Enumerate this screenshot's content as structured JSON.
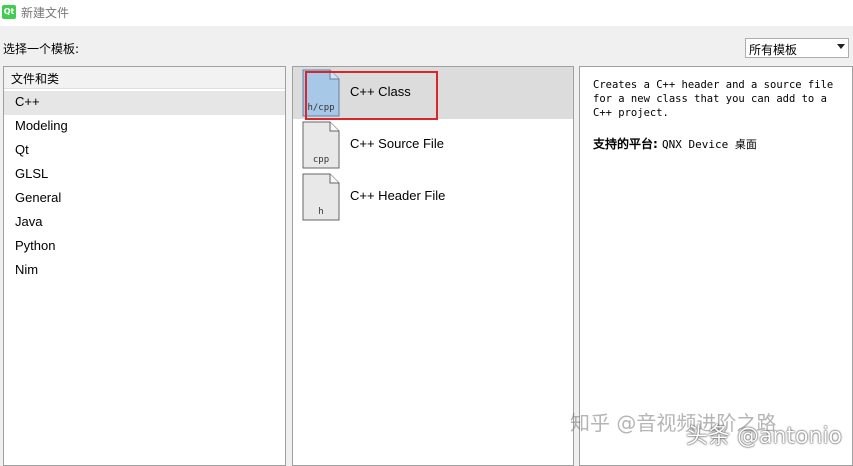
{
  "window": {
    "title": "新建文件",
    "app_icon": "Qt"
  },
  "prompt": "选择一个模板:",
  "filter": {
    "selected": "所有模板"
  },
  "categories": {
    "header": "文件和类",
    "items": [
      {
        "label": "C++",
        "selected": true
      },
      {
        "label": "Modeling"
      },
      {
        "label": "Qt"
      },
      {
        "label": "GLSL"
      },
      {
        "label": "General"
      },
      {
        "label": "Java"
      },
      {
        "label": "Python"
      },
      {
        "label": "Nim"
      }
    ]
  },
  "templates": [
    {
      "label": "C++ Class",
      "icon_text": "h/cpp",
      "selected": true,
      "icon_color": "#a8c8e8"
    },
    {
      "label": "C++ Source File",
      "icon_text": "cpp",
      "icon_color": "#e8e8e8"
    },
    {
      "label": "C++ Header File",
      "icon_text": "h",
      "icon_color": "#e8e8e8"
    }
  ],
  "details": {
    "description": "Creates a C++ header and a source file for a new class that you can add to a C++ project.",
    "platforms_label": "支持的平台",
    "platforms_value": "QNX Device 桌面"
  },
  "watermarks": {
    "zhihu": "知乎 @音视频进阶之路",
    "toutiao": "头条 @antonio"
  },
  "colors": {
    "highlight": "#d9262b",
    "selection": "#dcdcdc"
  }
}
